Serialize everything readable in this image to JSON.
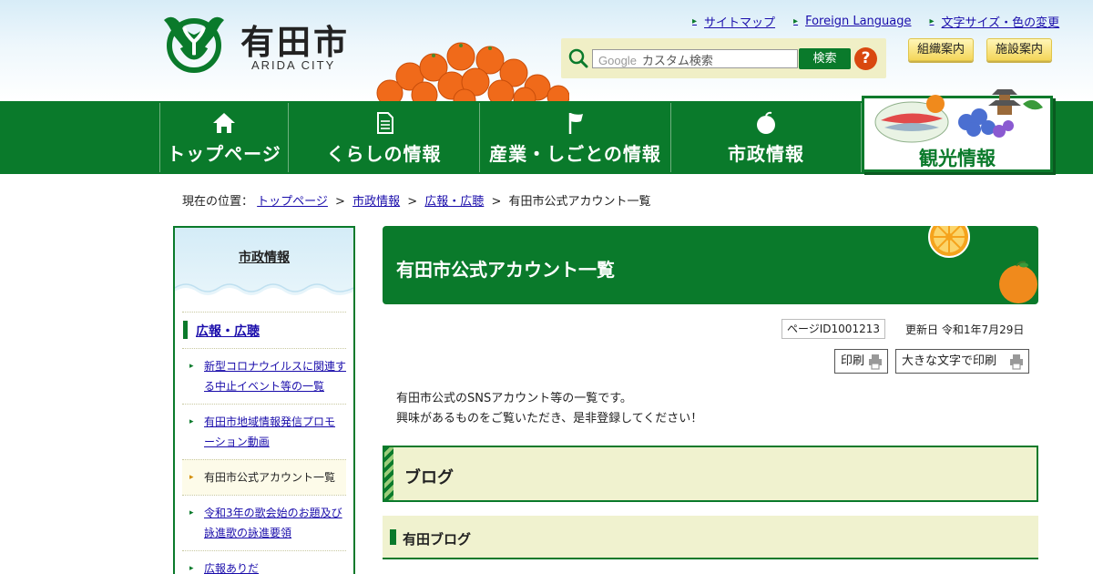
{
  "header": {
    "logo_text": "有田市",
    "logo_sub": "ARIDA CITY",
    "links": [
      "サイトマップ",
      "Foreign Language",
      "文字サイズ・色の変更"
    ],
    "search": {
      "brand": "Google",
      "placeholder": "カスタム検索",
      "button_label": "検索",
      "help": "?"
    },
    "utility": [
      "組織案内",
      "施設案内"
    ]
  },
  "nav": {
    "items": [
      {
        "label": "トップページ",
        "icon": "house-icon"
      },
      {
        "label": "くらしの情報",
        "icon": "document-icon"
      },
      {
        "label": "産業・しごとの情報",
        "icon": "flag-icon"
      },
      {
        "label": "市政情報",
        "icon": "orange-icon"
      },
      {
        "label": "観光情報",
        "icon": "tourism-illustration"
      }
    ]
  },
  "breadcrumb": {
    "prefix": "現在の位置：",
    "items": [
      "トップページ",
      "市政情報",
      "広報・広聴"
    ],
    "sep": ">",
    "current": "有田市公式アカウント一覧"
  },
  "sidebar": {
    "title": "市政情報",
    "section": "広報・広聴",
    "items": [
      {
        "label": "新型コロナウイルスに関連する中止イベント等の一覧",
        "current": false
      },
      {
        "label": "有田市地域情報発信プロモーション動画",
        "current": false
      },
      {
        "label": "有田市公式アカウント一覧",
        "current": true
      },
      {
        "label": "令和3年の歌会始のお題及び詠進歌の詠進要領",
        "current": false
      },
      {
        "label": "広報ありだ",
        "current": false
      }
    ]
  },
  "main": {
    "title": "有田市公式アカウント一覧",
    "page_id": "ページID1001213",
    "updated": "更新日 令和1年7月29日",
    "print_label": "印刷",
    "print_large_label": "大きな文字で印刷",
    "intro_lines": [
      "有田市公式のSNSアカウント等の一覧です。",
      "興味があるものをご覧いただき、是非登録してください！"
    ],
    "h2": "ブログ",
    "h3": "有田ブログ"
  },
  "colors": {
    "brand_green": "#0a7a2b",
    "section_bg": "#f0f2cf",
    "accent_orange": "#f08a1c",
    "help_red": "#d9480f"
  }
}
